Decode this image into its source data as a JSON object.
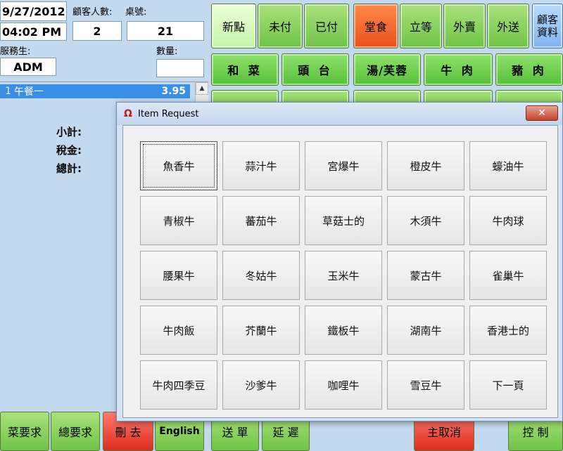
{
  "header": {
    "date": "9/27/2012",
    "time": "04:02 PM",
    "guest_label": "顧客人數:",
    "table_label": "桌號:",
    "guest_count": "2",
    "table_number": "21",
    "server_label": "服務生:",
    "server": "ADM",
    "qty_label": "數量:",
    "qty_value": ""
  },
  "status_tabs": [
    {
      "label": "新點"
    },
    {
      "label": "未付"
    },
    {
      "label": "已付"
    }
  ],
  "service_tabs": [
    {
      "label": "堂食"
    },
    {
      "label": "立等"
    },
    {
      "label": "外賣"
    },
    {
      "label": "外送"
    }
  ],
  "customer_btn": {
    "line1": "顧客",
    "line2": "資料"
  },
  "categories": [
    "和 菜",
    "頭 台",
    "湯/芙蓉",
    "牛 肉",
    "豬 肉"
  ],
  "order": {
    "items": [
      {
        "qty": "1",
        "name": "午餐一",
        "price": "3.95"
      }
    ],
    "subtotal_label": "小計:",
    "tax_label": "稅金:",
    "total_label": "總計:"
  },
  "bottom": {
    "dish_req": "菜要求",
    "all_req": "總要求",
    "delete": "刪 去",
    "english": "English",
    "send": "送 單",
    "delay": "延 遲",
    "main_cancel": "主取消",
    "control": "控 制"
  },
  "dialog": {
    "title": "Item Request",
    "close": "✕",
    "items": [
      "魚香牛",
      "蒜汁牛",
      "宮爆牛",
      "橙皮牛",
      "蠔油牛",
      "青椒牛",
      "蕃茄牛",
      "草菇士的",
      "木須牛",
      "牛肉球",
      "腰果牛",
      "冬姑牛",
      "玉米牛",
      "蒙古牛",
      "雀巢牛",
      "牛肉飯",
      "芥蘭牛",
      "鐵板牛",
      "湖南牛",
      "香港士的",
      "牛肉四季豆",
      "沙爹牛",
      "咖哩牛",
      "雪豆牛",
      "下一頁"
    ]
  }
}
